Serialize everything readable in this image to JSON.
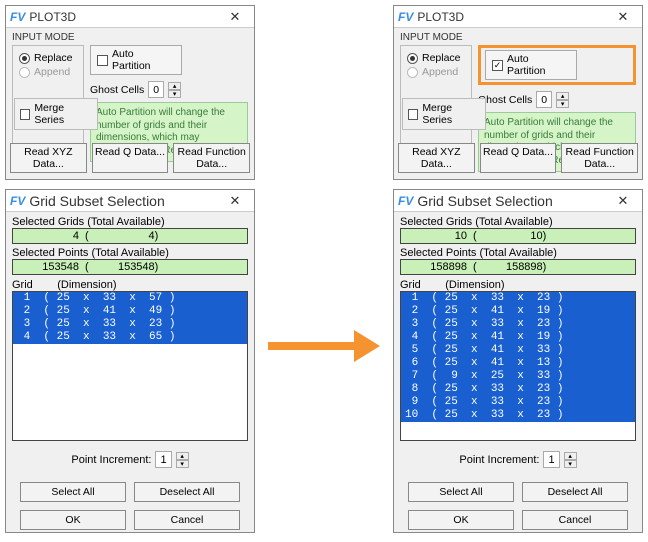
{
  "plot3d": {
    "title": "PLOT3D",
    "input_mode_label": "INPUT MODE",
    "replace_label": "Replace",
    "append_label": "Append",
    "auto_partition_label": "Auto Partition",
    "ghost_cells_label": "Ghost Cells",
    "ghost_cells_value": "0",
    "merge_series_label": "Merge Series",
    "note": "Auto Partition will change the number of grids and their dimensions, which may invalidate your Restarts.",
    "read_xyz": "Read XYZ Data...",
    "read_q": "Read Q Data...",
    "read_fn": "Read Function Data..."
  },
  "gridsel": {
    "title": "Grid Subset Selection",
    "sel_grids_label": "Selected Grids   (Total Available)",
    "sel_points_label": "Selected Points  (Total Available)",
    "grid_dim_label": "Grid        (Dimension)",
    "point_increment_label": "Point Increment:",
    "point_increment_value": "1",
    "select_all": "Select All",
    "deselect_all": "Deselect All",
    "ok": "OK",
    "cancel": "Cancel"
  },
  "left": {
    "auto_partition_checked": false,
    "grids_sel": "4",
    "grids_tot": "4",
    "pts_sel": "153548",
    "pts_tot": "153548",
    "rows": [
      " 1  ( 25  x  33  x  57 )",
      " 2  ( 25  x  41  x  49 )",
      " 3  ( 25  x  33  x  23 )",
      " 4  ( 25  x  33  x  65 )"
    ]
  },
  "right": {
    "auto_partition_checked": true,
    "grids_sel": "10",
    "grids_tot": "10",
    "pts_sel": "158898",
    "pts_tot": "158898",
    "rows": [
      " 1  ( 25  x  33  x  23 )",
      " 2  ( 25  x  41  x  19 )",
      " 3  ( 25  x  33  x  23 )",
      " 4  ( 25  x  41  x  19 )",
      " 5  ( 25  x  41  x  33 )",
      " 6  ( 25  x  41  x  13 )",
      " 7  (  9  x  25  x  33 )",
      " 8  ( 25  x  33  x  23 )",
      " 9  ( 25  x  33  x  23 )",
      "10  ( 25  x  33  x  23 )"
    ]
  }
}
